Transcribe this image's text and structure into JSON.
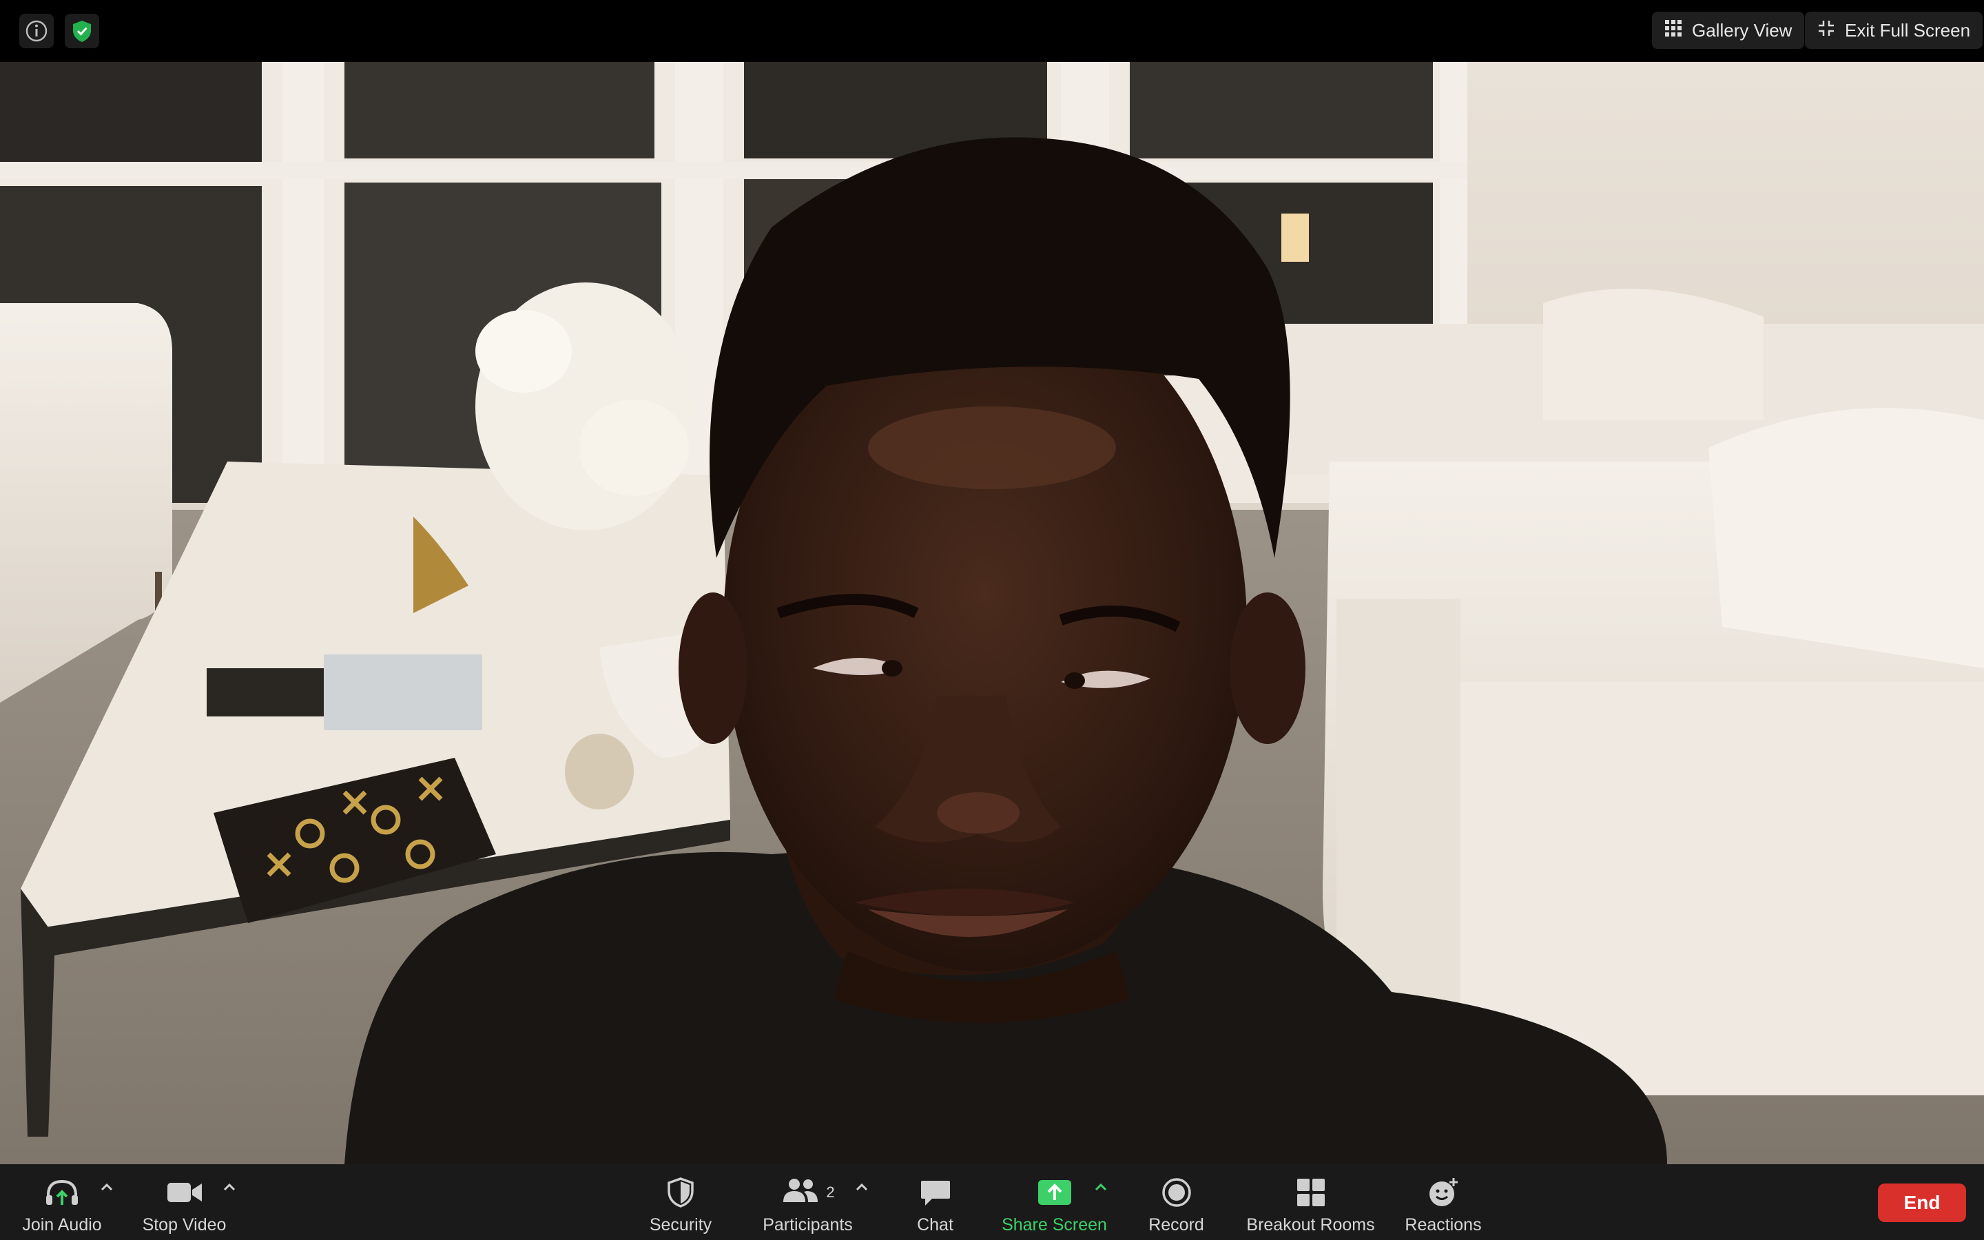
{
  "colors": {
    "accent_green": "#3ed068",
    "end_red": "#d9302b",
    "toolbar_bg": "#1a1a1a"
  },
  "topbar": {
    "info_icon": "info-icon",
    "security_icon": "green-shield-icon",
    "gallery_view_label": "Gallery View",
    "exit_fullscreen_label": "Exit Full Screen"
  },
  "video": {
    "description_icon": "participant-video"
  },
  "toolbar": {
    "join_audio_label": "Join Audio",
    "stop_video_label": "Stop Video",
    "security_label": "Security",
    "participants_label": "Participants",
    "participants_count": "2",
    "chat_label": "Chat",
    "share_screen_label": "Share Screen",
    "record_label": "Record",
    "breakout_rooms_label": "Breakout Rooms",
    "reactions_label": "Reactions",
    "end_label": "End"
  }
}
